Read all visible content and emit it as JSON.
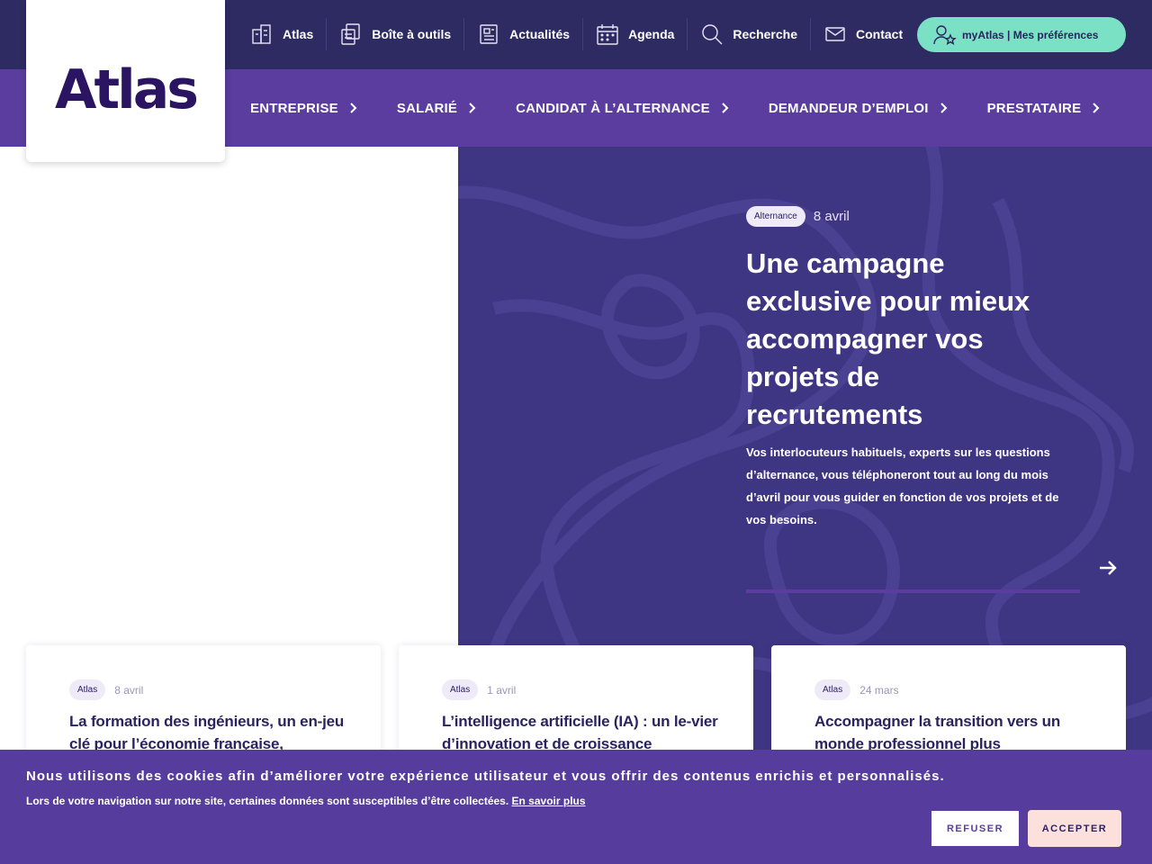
{
  "header": {
    "logo_text": "Atlas",
    "top_links": [
      {
        "label": "Atlas",
        "icon": "buildings-icon"
      },
      {
        "label": "Boîte à outils",
        "icon": "documents-icon"
      },
      {
        "label": "Actualités",
        "icon": "newspaper-icon"
      },
      {
        "label": "Agenda",
        "icon": "calendar-icon"
      },
      {
        "label": "Recherche",
        "icon": "search-icon"
      },
      {
        "label": "Contact",
        "icon": "mail-icon"
      }
    ],
    "myatlas_label": "myAtlas | Mes préférences",
    "main_nav": [
      {
        "label": "ENTREPRISE"
      },
      {
        "label": "SALARIÉ"
      },
      {
        "label": "CANDIDAT À L’ALTERNANCE"
      },
      {
        "label": "DEMANDEUR D’EMPLOI"
      },
      {
        "label": "PRESTATAIRE"
      }
    ]
  },
  "hero": {
    "tag": "Alternance",
    "date": "8 avril",
    "title": "Une campagne exclusive pour mieux accompagner vos projets de recrutements",
    "description": "Vos interlocuteurs habituels, experts sur les questions d’alternance, vous téléphoneront tout au long du mois d’avril pour vous guider en fonction de vos projets et de vos besoins."
  },
  "news": [
    {
      "tag": "Atlas",
      "date": "8 avril",
      "title": "La formation des ingénieurs, un en-jeu clé pour l’économie française,"
    },
    {
      "tag": "Atlas",
      "date": "1 avril",
      "title": "L’intelligence artificielle (IA) : un le-vier d’innovation et de croissance"
    },
    {
      "tag": "Atlas",
      "date": "24 mars",
      "title": "Accompagner la transition vers un monde professionnel plus"
    }
  ],
  "cookie": {
    "message": "Nous utilisons des cookies afin d’améliorer votre expérience utilisateur et vous offrir des contenus enrichis et personnalisés.",
    "detail": "Lors de votre navigation sur notre site, certaines données sont susceptibles d’être collectées.",
    "link": "En savoir plus",
    "refuse": "REFUSER",
    "accept": "ACCEPTER"
  },
  "colors": {
    "topbar": "#2e2b63",
    "nav": "#5a3d9f",
    "hero": "#3e3583",
    "mint": "#7ae1c4",
    "accept": "#fce0dc"
  }
}
